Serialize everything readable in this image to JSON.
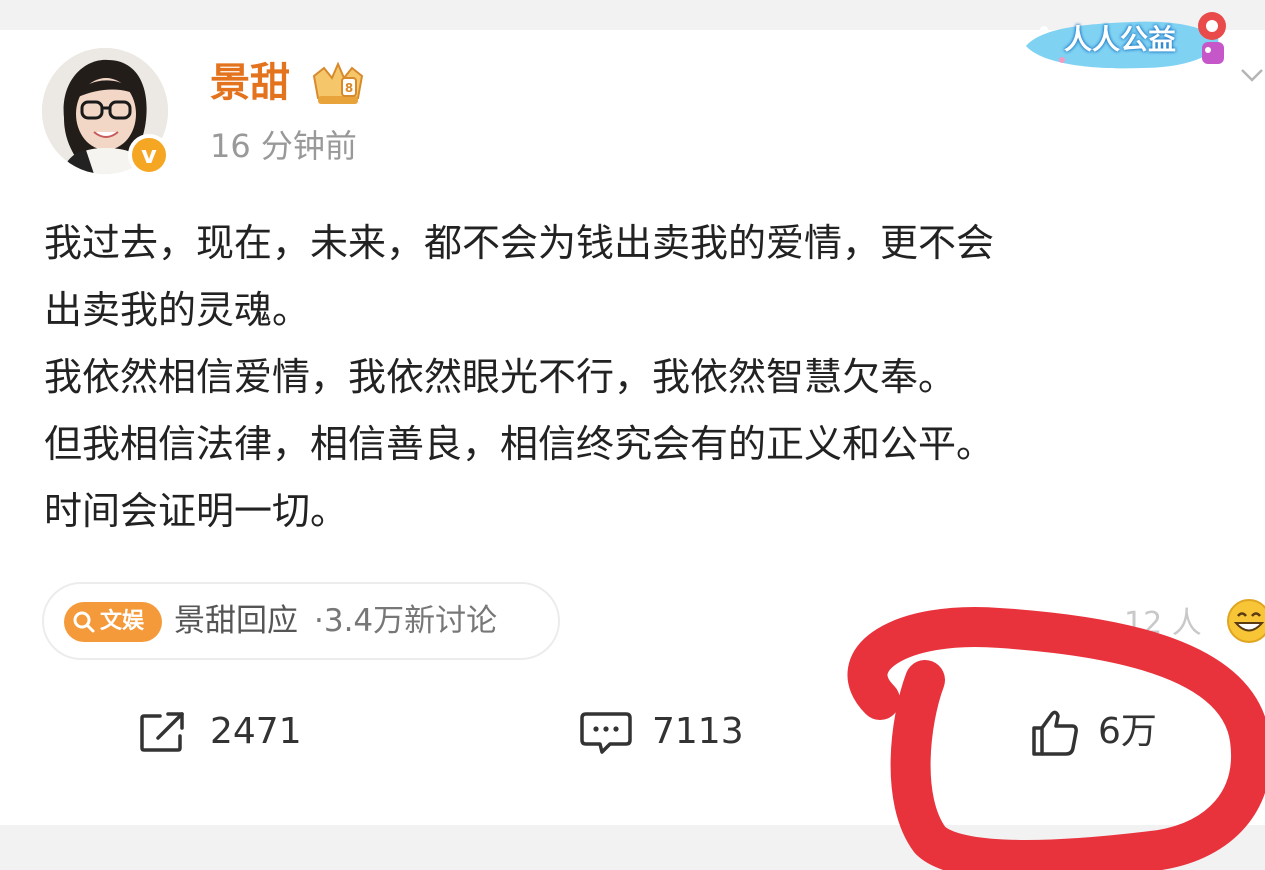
{
  "post": {
    "author": "景甜",
    "time": "16 分钟前",
    "promo_badge": "人人公益",
    "text_lines": [
      "我过去，现在，未来，都不会为钱出卖我的爱情，更不会",
      "出卖我的灵魂。",
      "我依然相信爱情，我依然眼光不行，我依然智慧欠奉。",
      "但我相信法律，相信善良，相信终究会有的正义和公平。",
      "时间会证明一切。"
    ]
  },
  "topic": {
    "tag": "文娱",
    "title": "景甜回应",
    "count": "·3.4万新讨论"
  },
  "people": {
    "count": "12 人"
  },
  "actions": {
    "repost": "2471",
    "comment": "7113",
    "like": "6万"
  },
  "colors": {
    "username": "#e4731e",
    "accent_orange": "#f59a3a",
    "annotation_red": "#e8333d"
  },
  "icons": [
    "crown-badge-icon",
    "verified-v-icon",
    "chevron-down-icon",
    "search-icon",
    "repost-icon",
    "comment-icon",
    "thumbs-up-icon",
    "grin-emoji-icon"
  ]
}
